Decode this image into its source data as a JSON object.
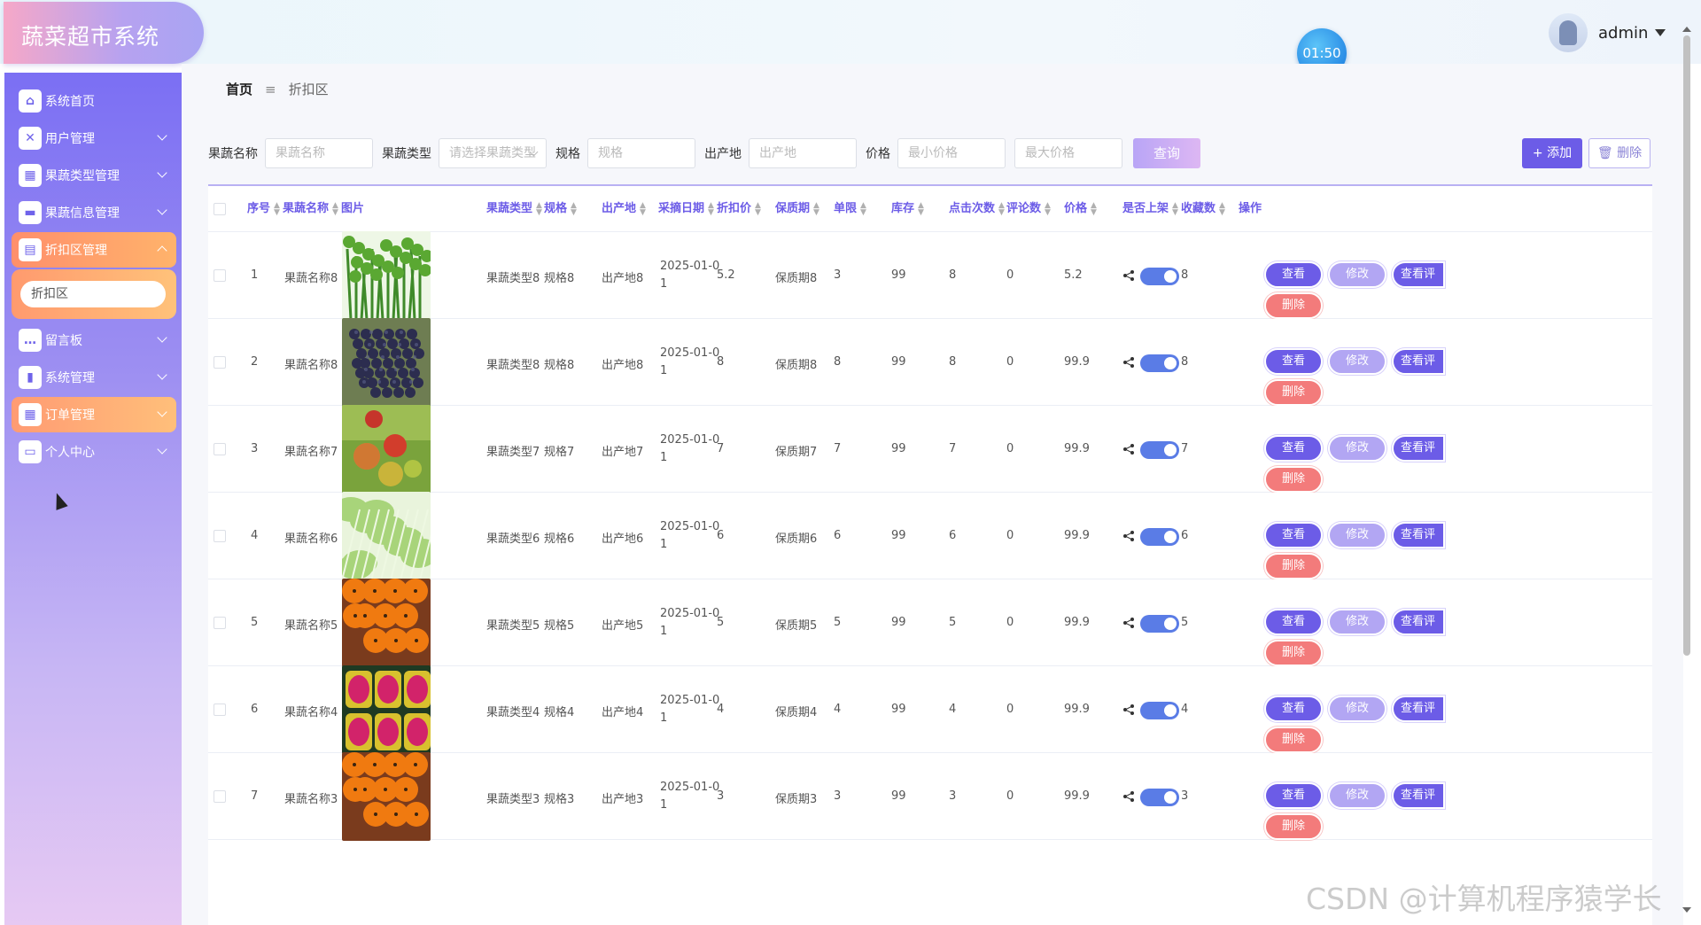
{
  "app": {
    "title": "蔬菜超市系统",
    "timer": "01:50",
    "user": "admin"
  },
  "sidebar": {
    "items": [
      {
        "label": "系统首页",
        "icon": "home-icon",
        "glyph": "⌂"
      },
      {
        "label": "用户管理",
        "icon": "clipboard-x-icon",
        "glyph": "✕"
      },
      {
        "label": "果蔬类型管理",
        "icon": "grid-icon",
        "glyph": "▦"
      },
      {
        "label": "果蔬信息管理",
        "icon": "sign-icon",
        "glyph": "▬"
      },
      {
        "label": "折扣区管理",
        "icon": "briefcase-icon",
        "glyph": "▤"
      },
      {
        "label": "留言板",
        "icon": "chat-icon",
        "glyph": "…"
      },
      {
        "label": "系统管理",
        "icon": "bar-chart-icon",
        "glyph": "▮"
      },
      {
        "label": "订单管理",
        "icon": "apps-icon",
        "glyph": "▦"
      },
      {
        "label": "个人中心",
        "icon": "card-icon",
        "glyph": "▭"
      }
    ],
    "submenu": {
      "label": "折扣区"
    }
  },
  "breadcrumb": {
    "home": "首页",
    "separator": "≡",
    "current": "折扣区"
  },
  "search": {
    "name_label": "果蔬名称",
    "name_placeholder": "果蔬名称",
    "type_label": "果蔬类型",
    "type_placeholder": "请选择果蔬类型",
    "spec_label": "规格",
    "spec_placeholder": "规格",
    "origin_label": "出产地",
    "origin_placeholder": "出产地",
    "price_label": "价格",
    "min_placeholder": "最小价格",
    "max_placeholder": "最大价格",
    "query_label": "查询"
  },
  "actions": {
    "add_label": "+ 添加",
    "delete_label": "删除"
  },
  "columns": [
    "序号",
    "果蔬名称",
    "图片",
    "果蔬类型",
    "规格",
    "出产地",
    "采摘日期",
    "折扣价",
    "保质期",
    "单限",
    "库存",
    "点击次数",
    "评论数",
    "价格",
    "是否上架",
    "收藏数",
    "操作"
  ],
  "row_buttons": {
    "view": "查看",
    "edit": "修改",
    "review": "查看评论",
    "delete": "删除"
  },
  "rows": [
    {
      "idx": "1",
      "name": "果蔬名称8",
      "image": "celery",
      "type": "果蔬类型8",
      "spec": "规格8",
      "origin": "出产地8",
      "date1": "2025-01-0",
      "date2": "1",
      "discount": "5.2",
      "shelf": "保质期8",
      "limit": "3",
      "stock": "99",
      "clicks": "8",
      "comments": "0",
      "price": "5.2",
      "favorites": "8"
    },
    {
      "idx": "2",
      "name": "果蔬名称8",
      "image": "grapes",
      "type": "果蔬类型8",
      "spec": "规格8",
      "origin": "出产地8",
      "date1": "2025-01-0",
      "date2": "1",
      "discount": "8",
      "shelf": "保质期8",
      "limit": "8",
      "stock": "99",
      "clicks": "8",
      "comments": "0",
      "price": "99.9",
      "favorites": "8"
    },
    {
      "idx": "3",
      "name": "果蔬名称7",
      "image": "plums",
      "type": "果蔬类型7",
      "spec": "规格7",
      "origin": "出产地7",
      "date1": "2025-01-0",
      "date2": "1",
      "discount": "7",
      "shelf": "保质期7",
      "limit": "7",
      "stock": "99",
      "clicks": "7",
      "comments": "0",
      "price": "99.9",
      "favorites": "7"
    },
    {
      "idx": "4",
      "name": "果蔬名称6",
      "image": "lettuce",
      "type": "果蔬类型6",
      "spec": "规格6",
      "origin": "出产地6",
      "date1": "2025-01-0",
      "date2": "1",
      "discount": "6",
      "shelf": "保质期6",
      "limit": "6",
      "stock": "99",
      "clicks": "6",
      "comments": "0",
      "price": "99.9",
      "favorites": "6"
    },
    {
      "idx": "5",
      "name": "果蔬名称5",
      "image": "oranges",
      "type": "果蔬类型5",
      "spec": "规格5",
      "origin": "出产地5",
      "date1": "2025-01-0",
      "date2": "1",
      "discount": "5",
      "shelf": "保质期5",
      "limit": "5",
      "stock": "99",
      "clicks": "5",
      "comments": "0",
      "price": "99.9",
      "favorites": "5"
    },
    {
      "idx": "6",
      "name": "果蔬名称4",
      "image": "dragonfruit",
      "type": "果蔬类型4",
      "spec": "规格4",
      "origin": "出产地4",
      "date1": "2025-01-0",
      "date2": "1",
      "discount": "4",
      "shelf": "保质期4",
      "limit": "4",
      "stock": "99",
      "clicks": "4",
      "comments": "0",
      "price": "99.9",
      "favorites": "4"
    },
    {
      "idx": "7",
      "name": "果蔬名称3",
      "image": "oranges",
      "type": "果蔬类型3",
      "spec": "规格3",
      "origin": "出产地3",
      "date1": "2025-01-0",
      "date2": "1",
      "discount": "3",
      "shelf": "保质期3",
      "limit": "3",
      "stock": "99",
      "clicks": "3",
      "comments": "0",
      "price": "99.9",
      "favorites": "3"
    }
  ],
  "watermark": "CSDN @计算机程序猿学长",
  "colors": {
    "accent": "#6c5ce7",
    "danger": "#f37b7b",
    "active_menu": "#ff9b6b"
  }
}
